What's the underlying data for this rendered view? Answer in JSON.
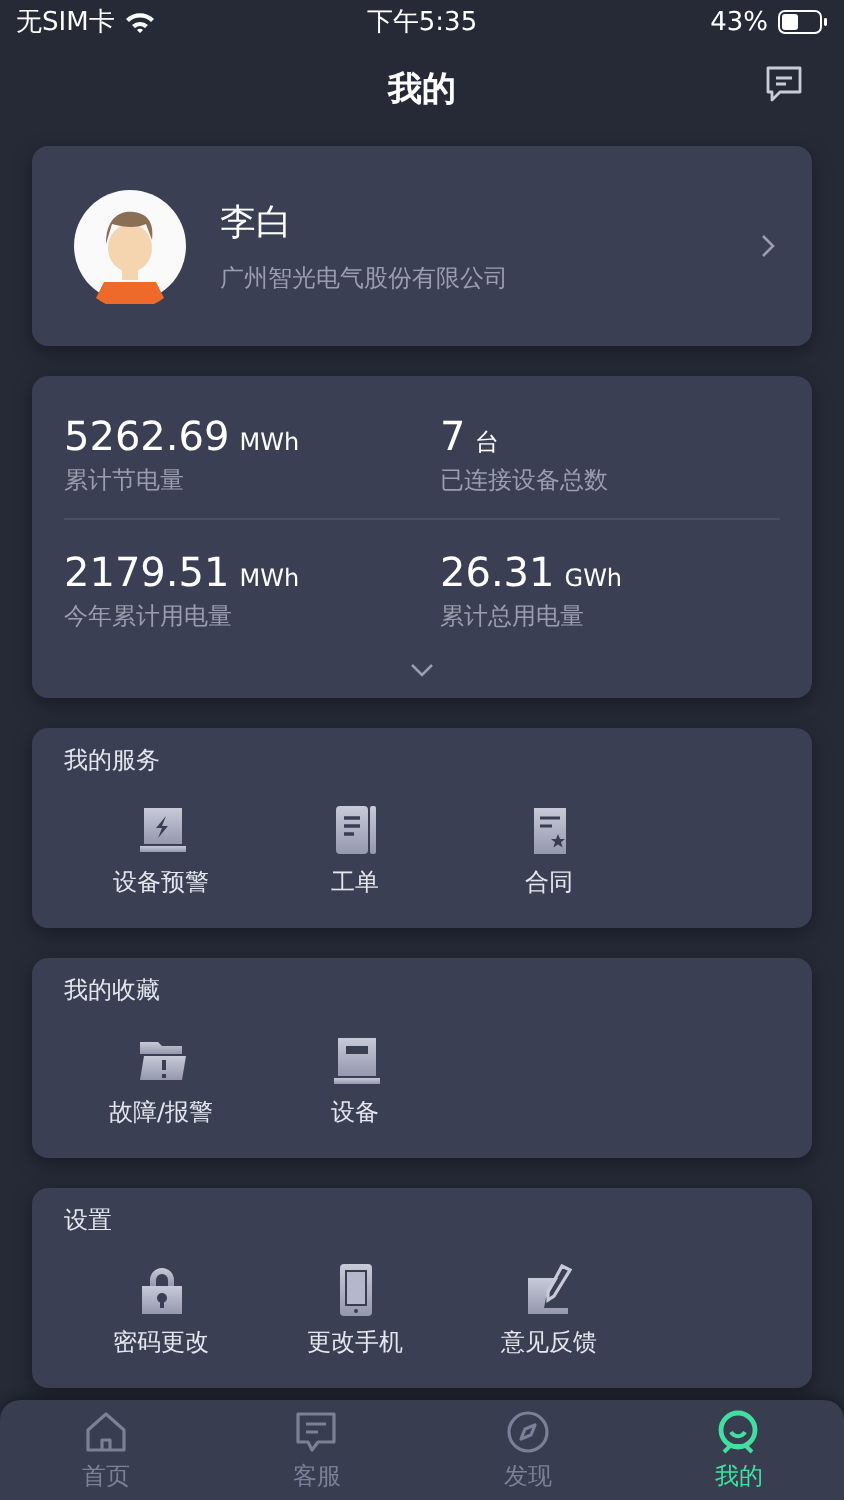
{
  "status_bar": {
    "carrier": "无SIM卡",
    "time": "下午5:35",
    "battery": "43%"
  },
  "header": {
    "title": "我的"
  },
  "profile": {
    "name": "李白",
    "company": "广州智光电气股份有限公司"
  },
  "stats": [
    {
      "value": "5262.69",
      "unit": "MWh",
      "label": "累计节电量"
    },
    {
      "value": "7",
      "unit": "台",
      "label": "已连接设备总数"
    },
    {
      "value": "2179.51",
      "unit": "MWh",
      "label": "今年累计用电量"
    },
    {
      "value": "26.31",
      "unit": "GWh",
      "label": "累计总用电量"
    }
  ],
  "sections": [
    {
      "title": "我的服务",
      "items": [
        {
          "label": "设备预警",
          "kind": "alert"
        },
        {
          "label": "工单",
          "kind": "order"
        },
        {
          "label": "合同",
          "kind": "contract"
        }
      ]
    },
    {
      "title": "我的收藏",
      "items": [
        {
          "label": "故障/报警",
          "kind": "fault"
        },
        {
          "label": "设备",
          "kind": "device"
        }
      ]
    },
    {
      "title": "设置",
      "items": [
        {
          "label": "密码更改",
          "kind": "lock"
        },
        {
          "label": "更改手机",
          "kind": "phone"
        },
        {
          "label": "意见反馈",
          "kind": "feedback"
        }
      ]
    }
  ],
  "tab_bar": [
    {
      "label": "首页",
      "kind": "home",
      "selected": false
    },
    {
      "label": "客服",
      "kind": "chat",
      "selected": false
    },
    {
      "label": "发现",
      "kind": "compass",
      "selected": false
    },
    {
      "label": "我的",
      "kind": "me",
      "selected": true
    }
  ]
}
